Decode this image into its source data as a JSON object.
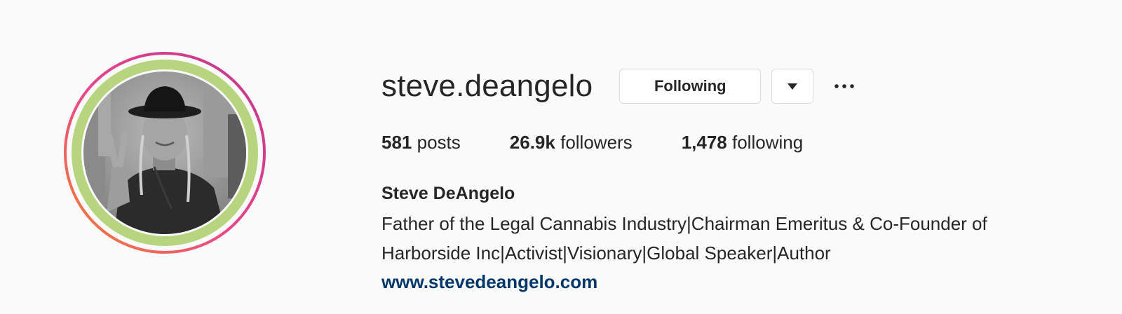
{
  "profile": {
    "username": "steve.deangelo",
    "following_button_label": "Following",
    "stats": {
      "posts_count": "581",
      "posts_label": "posts",
      "followers_count": "26.9k",
      "followers_label": "followers",
      "following_count": "1,478",
      "following_label": "following"
    },
    "full_name": "Steve DeAngelo",
    "bio_line_1": "Father of the Legal Cannabis Industry|Chairman Emeritus & Co-Founder of",
    "bio_line_2": "Harborside Inc|Activist|Visionary|Global Speaker|Author",
    "website": "www.stevedeangelo.com"
  },
  "icons": {
    "dropdown": "caret-down-icon",
    "more": "more-options-icon",
    "story_ring": "story-ring-icon"
  },
  "colors": {
    "background": "#fafafa",
    "text": "#262626",
    "link": "#00376b",
    "button_border": "#dbdbdb",
    "close_friends_ring": "#b7d57f",
    "story_gradient": [
      "#f58529",
      "#dd2a7b",
      "#c1358f"
    ]
  }
}
